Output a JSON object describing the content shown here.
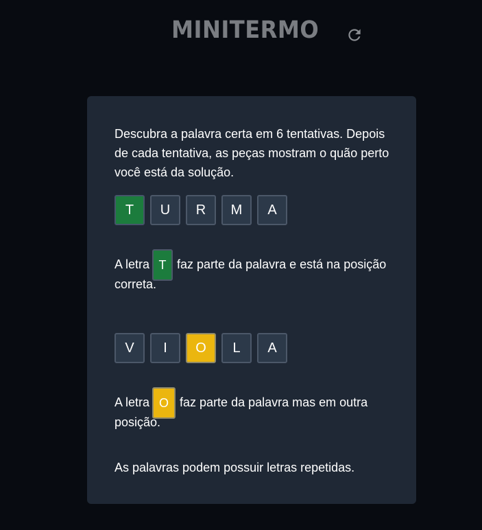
{
  "header": {
    "title": "MINITERMO",
    "restart_icon": "refresh-icon"
  },
  "help": {
    "intro": "Descubra a palavra certa em 6 tentativas. Depois de cada tentativa, as peças mostram o quão perto você está da solução.",
    "example1": {
      "letters": [
        "T",
        "U",
        "R",
        "M",
        "A"
      ],
      "highlight_index": 0,
      "highlight_state": "correct",
      "text_before": "A letra",
      "letter": "T",
      "text_after": "faz parte da palavra e está na posição correta."
    },
    "example2": {
      "letters": [
        "V",
        "I",
        "O",
        "L",
        "A"
      ],
      "highlight_index": 2,
      "highlight_state": "present",
      "text_before": "A letra",
      "letter": "O",
      "text_after": "faz parte da palavra mas em outra posição."
    },
    "note": "As palavras podem possuir letras repetidas."
  },
  "colors": {
    "background": "#080b11",
    "panel": "#1f2835",
    "tile": "#2c3949",
    "correct": "#1c7c3d",
    "present": "#ebb60f",
    "title": "#7a7d82"
  }
}
